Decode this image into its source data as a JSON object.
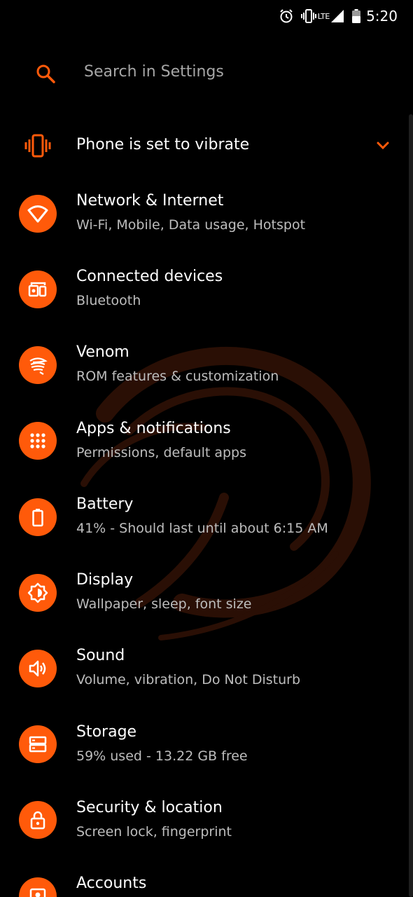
{
  "colors": {
    "accent": "#ff5a0a",
    "background": "#000000",
    "summary_text": "#bdbdbd",
    "hint_text": "#a6a6a6"
  },
  "status_bar": {
    "icons": [
      "alarm-icon",
      "vibrate-icon",
      "lte-signal-icon",
      "battery-icon"
    ],
    "network": "LTE",
    "time": "5:20"
  },
  "search": {
    "placeholder": "Search in Settings",
    "icon": "search-icon"
  },
  "condition": {
    "label": "Phone is set to vibrate",
    "icon": "vibrate-icon",
    "expand_icon": "chevron-down-icon"
  },
  "settings": [
    {
      "title": "Network & Internet",
      "summary": "Wi-Fi, Mobile, Data usage, Hotspot",
      "icon": "wifi-icon"
    },
    {
      "title": "Connected devices",
      "summary": "Bluetooth",
      "icon": "devices-icon"
    },
    {
      "title": "Venom",
      "summary": "ROM features & customization",
      "icon": "venom-snake-icon"
    },
    {
      "title": "Apps & notifications",
      "summary": "Permissions, default apps",
      "icon": "apps-grid-icon"
    },
    {
      "title": "Battery",
      "summary": "41% - Should last until about 6:15 AM",
      "icon": "battery-icon"
    },
    {
      "title": "Display",
      "summary": "Wallpaper, sleep, font size",
      "icon": "brightness-icon"
    },
    {
      "title": "Sound",
      "summary": "Volume, vibration, Do Not Disturb",
      "icon": "volume-icon"
    },
    {
      "title": "Storage",
      "summary": "59% used - 13.22 GB free",
      "icon": "storage-icon"
    },
    {
      "title": "Security & location",
      "summary": "Screen lock, fingerprint",
      "icon": "lock-icon"
    },
    {
      "title": "Accounts",
      "summary": "",
      "icon": "account-icon"
    }
  ]
}
